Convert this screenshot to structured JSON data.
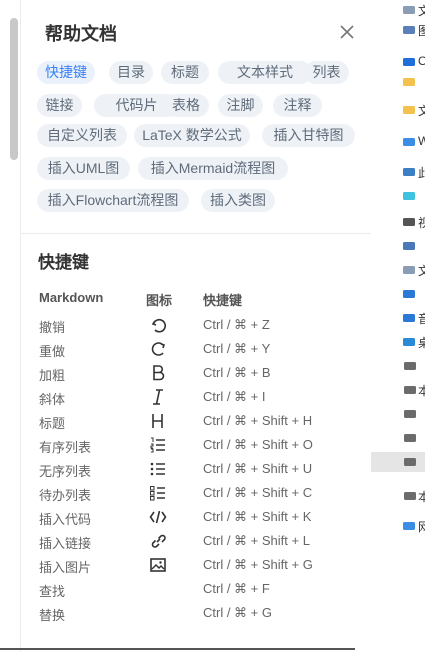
{
  "panel": {
    "title": "帮助文档",
    "tags": [
      {
        "label": "快捷键",
        "active": true
      },
      {
        "label": "目录"
      },
      {
        "label": "标题"
      },
      {
        "label": "文本样式"
      },
      {
        "label": "列表"
      },
      {
        "label": "链接"
      },
      {
        "label": "代码片"
      },
      {
        "label": "表格"
      },
      {
        "label": "注脚"
      },
      {
        "label": "注释"
      },
      {
        "label": "自定义列表"
      },
      {
        "label": "LaTeX 数学公式"
      },
      {
        "label": "插入甘特图"
      },
      {
        "label": "插入UML图"
      },
      {
        "label": "插入Mermaid流程图"
      },
      {
        "label": "插入Flowchart流程图"
      },
      {
        "label": "插入类图"
      }
    ],
    "section_title": "快捷键",
    "table_headers": [
      "Markdown",
      "图标",
      "快捷键"
    ],
    "rows": [
      {
        "name": "撤销",
        "icon": "undo-icon",
        "key": "Ctrl / ⌘ + Z"
      },
      {
        "name": "重做",
        "icon": "redo-icon",
        "key": "Ctrl / ⌘ + Y"
      },
      {
        "name": "加粗",
        "icon": "bold-icon",
        "key": "Ctrl / ⌘ + B"
      },
      {
        "name": "斜体",
        "icon": "italic-icon",
        "key": "Ctrl / ⌘ + I"
      },
      {
        "name": "标题",
        "icon": "heading-icon",
        "key": "Ctrl / ⌘ + Shift + H"
      },
      {
        "name": "有序列表",
        "icon": "ordered-list-icon",
        "key": "Ctrl / ⌘ + Shift + O"
      },
      {
        "name": "无序列表",
        "icon": "unordered-list-icon",
        "key": "Ctrl / ⌘ + Shift + U"
      },
      {
        "name": "待办列表",
        "icon": "todo-list-icon",
        "key": "Ctrl / ⌘ + Shift + C"
      },
      {
        "name": "插入代码",
        "icon": "code-icon",
        "key": "Ctrl / ⌘ + Shift + K"
      },
      {
        "name": "插入链接",
        "icon": "link-icon",
        "key": "Ctrl / ⌘ + Shift + L"
      },
      {
        "name": "插入图片",
        "icon": "image-icon",
        "key": "Ctrl / ⌘ + Shift + G"
      },
      {
        "name": "查找",
        "icon": "",
        "key": "Ctrl / ⌘ + F"
      },
      {
        "name": "替换",
        "icon": "",
        "key": "Ctrl / ⌘ + G"
      }
    ]
  },
  "explorer": {
    "items": [
      {
        "icon": "document-icon",
        "text": "文"
      },
      {
        "icon": "image-file-icon",
        "text": "图"
      },
      {
        "icon": "onedrive-icon",
        "text": "O"
      },
      {
        "icon": "folder-icon",
        "text": ""
      },
      {
        "icon": "folder-icon",
        "text": "文"
      },
      {
        "icon": "cloud-icon",
        "text": "W"
      },
      {
        "icon": "computer-icon",
        "text": "此"
      },
      {
        "icon": "3d-objects-icon",
        "text": ""
      },
      {
        "icon": "video-icon",
        "text": "视"
      },
      {
        "icon": "pictures-icon",
        "text": ""
      },
      {
        "icon": "documents-icon",
        "text": "文"
      },
      {
        "icon": "downloads-icon",
        "text": ""
      },
      {
        "icon": "music-icon",
        "text": "音"
      },
      {
        "icon": "desktop-icon",
        "text": "桌"
      },
      {
        "icon": "drive-icon",
        "text": ""
      },
      {
        "icon": "drive-icon",
        "text": "本"
      },
      {
        "icon": "drive-icon",
        "text": ""
      },
      {
        "icon": "drive-icon",
        "text": ""
      },
      {
        "icon": "drive-icon",
        "text": "",
        "selected": true
      },
      {
        "icon": "drive-icon",
        "text": "本"
      },
      {
        "icon": "network-icon",
        "text": "网"
      }
    ]
  }
}
